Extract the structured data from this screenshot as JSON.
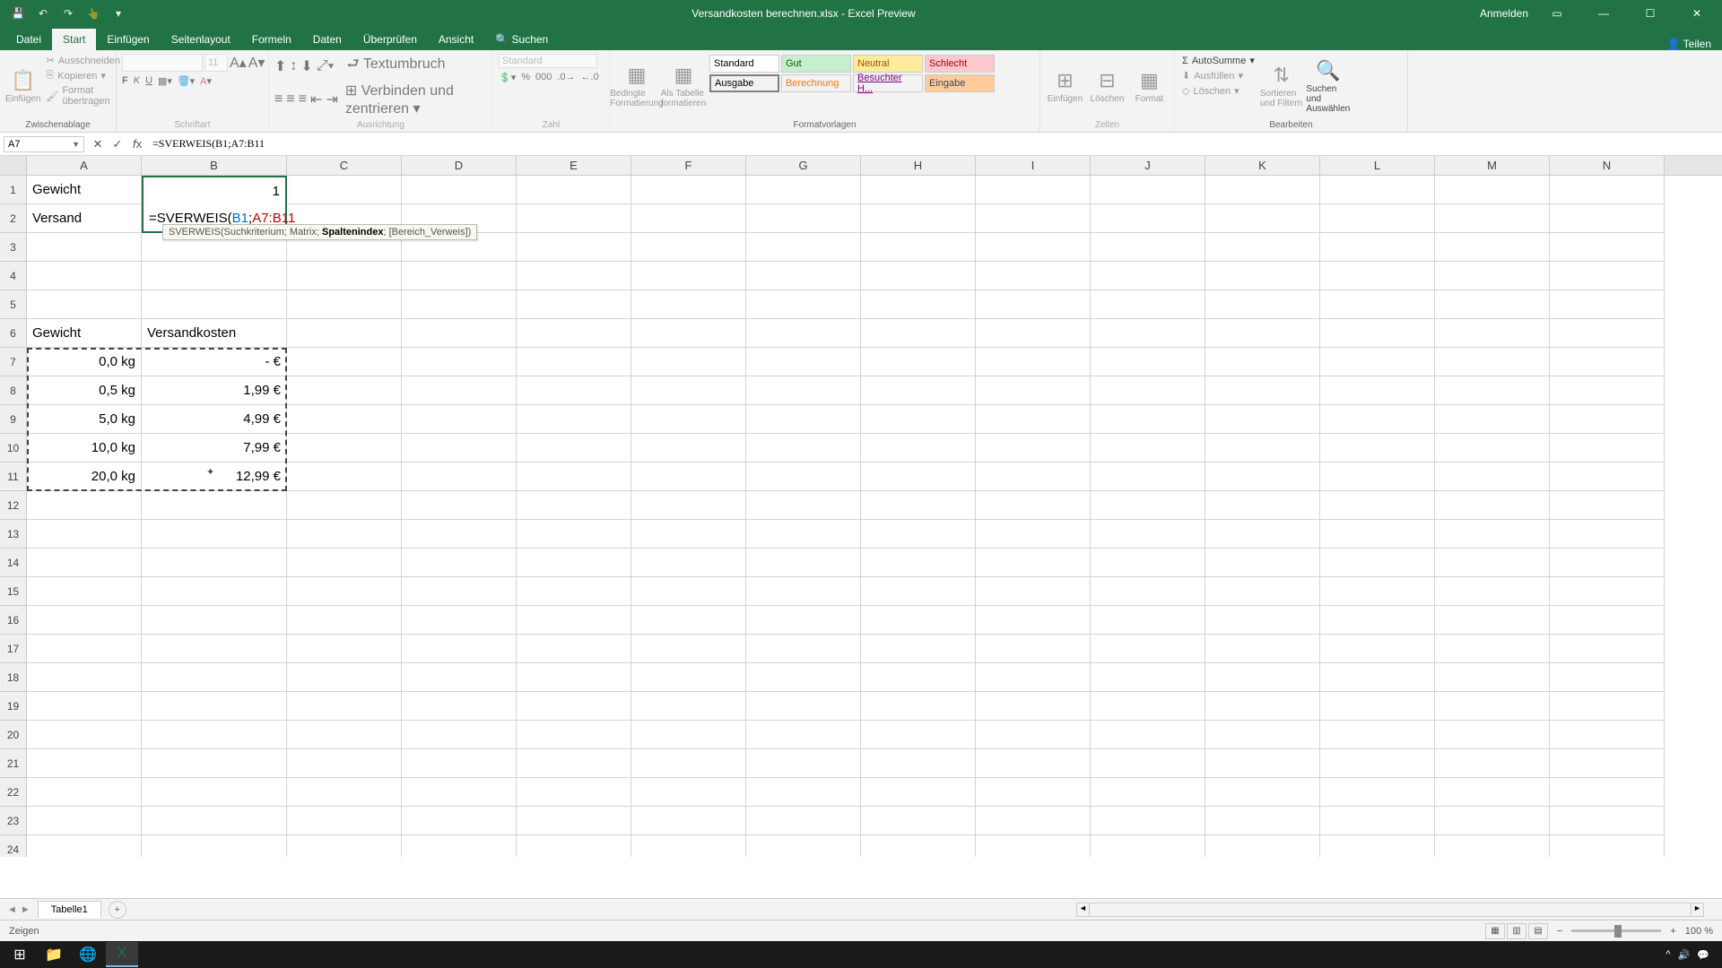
{
  "title": "Versandkosten berechnen.xlsx - Excel Preview",
  "titlebar": {
    "signin": "Anmelden"
  },
  "tabs": {
    "datei": "Datei",
    "start": "Start",
    "einfuegen": "Einfügen",
    "seitenlayout": "Seitenlayout",
    "formeln": "Formeln",
    "daten": "Daten",
    "ueberpruefen": "Überprüfen",
    "ansicht": "Ansicht",
    "suchen": "Suchen",
    "teilen": "Teilen"
  },
  "ribbon": {
    "einfuegen": "Einfügen",
    "ausschneiden": "Ausschneiden",
    "kopieren": "Kopieren",
    "format_uebertragen": "Format übertragen",
    "zwischenablage": "Zwischenablage",
    "schriftart": "Schriftart",
    "font_size": "11",
    "ausrichtung": "Ausrichtung",
    "textumbruch": "Textumbruch",
    "verbinden": "Verbinden und zentrieren",
    "zahl": "Zahl",
    "zahlformat": "Standard",
    "formatvorlagen": "Formatvorlagen",
    "bedingte": "Bedingte Formatierung",
    "als_tabelle": "Als Tabelle formatieren",
    "style_standard": "Standard",
    "style_gut": "Gut",
    "style_neutral": "Neutral",
    "style_schlecht": "Schlecht",
    "style_ausgabe": "Ausgabe",
    "style_berechnung": "Berechnung",
    "style_besuchter": "Besuchter H...",
    "style_eingabe": "Eingabe",
    "zellen": "Zellen",
    "zellen_einfuegen": "Einfügen",
    "loeschen": "Löschen",
    "format": "Format",
    "bearbeiten": "Bearbeiten",
    "autosumme": "AutoSumme",
    "ausfuellen": "Ausfüllen",
    "loeschen2": "Löschen",
    "sortieren": "Sortieren und Filtern",
    "suchen_auswaehlen": "Suchen und Auswählen"
  },
  "formulabar": {
    "namebox": "A7",
    "formula": "=SVERWEIS(B1;A7:B11",
    "formula_prefix": "=SVERWEIS(",
    "ref_b1": "B1",
    "sep": ";",
    "ref_a7b11": "A7:B11"
  },
  "tooltip": {
    "fn": "SVERWEIS(",
    "p1": "Suchkriterium",
    "p2": "Matrix",
    "p3_bold": "Spaltenindex",
    "p4": "[Bereich_Verweis]",
    "close": ")"
  },
  "columns": [
    "A",
    "B",
    "C",
    "D",
    "E",
    "F",
    "G",
    "H",
    "I",
    "J",
    "K",
    "L",
    "M",
    "N"
  ],
  "cells": {
    "A1": "Gewicht",
    "B1": "1",
    "A2": "Versand",
    "A6": "Gewicht",
    "B6": "Versandkosten",
    "A7": "0,0 kg",
    "B7": "-     €",
    "A8": "0,5 kg",
    "B8": "1,99 €",
    "A9": "5,0 kg",
    "B9": "4,99 €",
    "A10": "10,0 kg",
    "B10": "7,99 €",
    "A11": "20,0 kg",
    "B11": "12,99 €"
  },
  "sheet": {
    "name": "Tabelle1"
  },
  "status": {
    "mode": "Zeigen",
    "zoom": "100 %"
  }
}
